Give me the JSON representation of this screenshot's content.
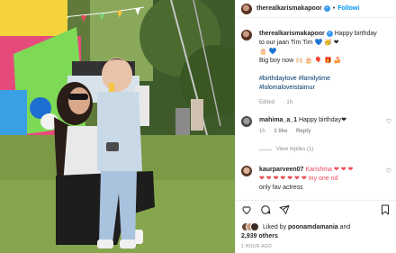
{
  "post": {
    "author": "therealkarismakapoor",
    "follow_label": "Followi",
    "dot": "•"
  },
  "caption": {
    "username": "therealkarismakapoor",
    "text_line1": "Happy birthday to our jaan Tim Tim 💙 🥳 ❤",
    "text_line2": "🎂 💙",
    "text_line3": "Big boy now 🙌🏻 🎂 🎈 🎁 🍰",
    "hashtags": "#birthdaylove #familytime #lolomaloveistaimur",
    "edited_label": "Edited",
    "edited_time": "1h"
  },
  "comments": [
    {
      "username": "mahima_a_1",
      "text": "Happy birthday❤",
      "time": "1h",
      "likes": "1 like",
      "reply_label": "Reply",
      "view_replies": "View replies (1)"
    },
    {
      "username": "kaurparveen07",
      "text_line1": "Karishma ❤ ❤ ❤",
      "text_line2": "❤ ❤ ❤ ❤ ❤ ❤ ❤ my one nd",
      "text_line3": "only fav actress"
    }
  ],
  "likes": {
    "prefix": "Liked by",
    "user": "poonamdamania",
    "and": "and",
    "count": "2,939 others"
  },
  "timestamp": "1 HOUR AGO",
  "icons": [
    "heart-icon",
    "comment-icon",
    "share-icon",
    "bookmark-icon"
  ],
  "colors": {
    "link": "#0095f6",
    "hashtag": "#00376b",
    "meta": "#8e8e8e",
    "heart": "#ed4956"
  }
}
